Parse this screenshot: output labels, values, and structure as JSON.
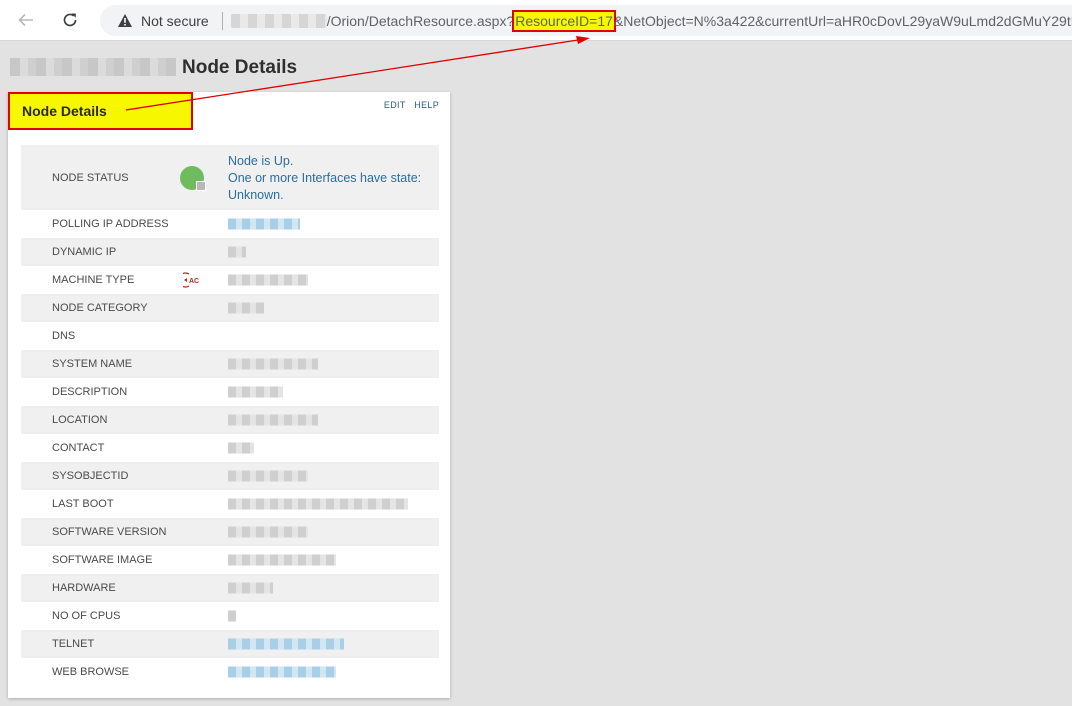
{
  "browser": {
    "security_label": "Not secure",
    "url_path": "/Orion/DetachResource.aspx?",
    "url_highlight": "ResourceID=17",
    "url_rest": "&NetObject=N%3a422&currentUrl=aHR0cDovL29yaW9uLmd2dGMuY29tL0"
  },
  "page": {
    "title": "Node Details"
  },
  "panel": {
    "title": "Node Details",
    "edit_label": "EDIT",
    "help_label": "HELP",
    "status": {
      "label": "NODE STATUS",
      "line1": "Node is Up.",
      "line2": "One or more Interfaces have state:",
      "line3": "Unknown."
    },
    "rows": [
      {
        "label": "POLLING IP ADDRESS"
      },
      {
        "label": "DYNAMIC IP"
      },
      {
        "label": "MACHINE TYPE",
        "icon": "AC"
      },
      {
        "label": "NODE CATEGORY"
      },
      {
        "label": "DNS"
      },
      {
        "label": "SYSTEM NAME"
      },
      {
        "label": "DESCRIPTION"
      },
      {
        "label": "LOCATION"
      },
      {
        "label": "CONTACT"
      },
      {
        "label": "SYSOBJECTID"
      },
      {
        "label": "LAST BOOT"
      },
      {
        "label": "SOFTWARE VERSION"
      },
      {
        "label": "SOFTWARE IMAGE"
      },
      {
        "label": "HARDWARE"
      },
      {
        "label": "NO OF CPUS"
      },
      {
        "label": "TELNET"
      },
      {
        "label": "WEB BROWSE"
      }
    ]
  },
  "colors": {
    "highlight": "#f7f700",
    "annotation": "#e00000",
    "link": "#2a6e9e",
    "status_up": "#6ebc5d"
  }
}
